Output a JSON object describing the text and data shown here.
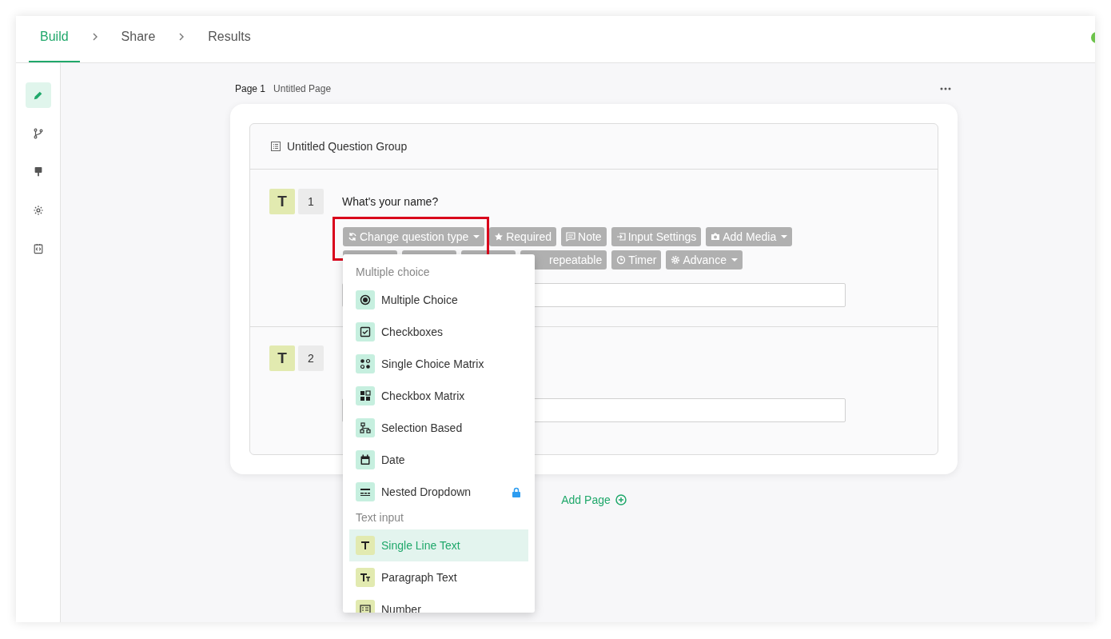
{
  "tabs": [
    {
      "label": "Build",
      "selected": true
    },
    {
      "label": "Share",
      "selected": false
    },
    {
      "label": "Results",
      "selected": false
    }
  ],
  "sidebar": {
    "items": [
      {
        "kind": "pencil",
        "selected": true
      },
      {
        "kind": "branch",
        "selected": false
      },
      {
        "kind": "brush",
        "selected": false
      },
      {
        "kind": "gear",
        "selected": false
      },
      {
        "kind": "code",
        "selected": false
      }
    ]
  },
  "page": {
    "number": "Page 1",
    "title": "Untitled Page"
  },
  "group": {
    "title": "Untitled Question Group"
  },
  "questions": [
    {
      "type": "T",
      "number": "1",
      "title": "What's your name?",
      "toolbar": [
        [
          {
            "kind": "refresh",
            "label": "Change question type",
            "caret": true
          },
          {
            "kind": "star",
            "label": "Required",
            "caret": false
          },
          {
            "kind": "note",
            "label": "Note",
            "caret": false
          },
          {
            "kind": "input",
            "label": "Input Settings",
            "caret": false
          },
          {
            "kind": "camera",
            "label": "Add Media",
            "caret": true
          }
        ],
        [
          {
            "kind": "covered"
          },
          {
            "kind": "covered"
          },
          {
            "kind": "covered"
          },
          {
            "kind": "cut",
            "label": "repeatable",
            "caret": false
          },
          {
            "kind": "clock",
            "label": "Timer",
            "caret": false
          },
          {
            "kind": "gear",
            "label": "Advance",
            "caret": true
          }
        ]
      ]
    },
    {
      "type": "T",
      "number": "2"
    }
  ],
  "type_menu": {
    "sections": [
      {
        "kind": "choice",
        "title": "Multiple choice",
        "items": [
          {
            "kind": "radio",
            "label": "Multiple Choice",
            "selected": false,
            "locked": false
          },
          {
            "kind": "checkbox",
            "label": "Checkboxes",
            "selected": false,
            "locked": false
          },
          {
            "kind": "dots",
            "label": "Single Choice Matrix",
            "selected": false,
            "locked": false
          },
          {
            "kind": "grid",
            "label": "Checkbox Matrix",
            "selected": false,
            "locked": false
          },
          {
            "kind": "tree",
            "label": "Selection Based",
            "selected": false,
            "locked": false
          },
          {
            "kind": "calendar",
            "label": "Date",
            "selected": false,
            "locked": false
          },
          {
            "kind": "nested",
            "label": "Nested Dropdown",
            "selected": false,
            "locked": true
          }
        ]
      },
      {
        "kind": "text",
        "title": "Text input",
        "items": [
          {
            "kind": "t",
            "label": "Single Line Text",
            "selected": true,
            "locked": false
          },
          {
            "kind": "tt",
            "label": "Paragraph Text",
            "selected": false,
            "locked": false
          },
          {
            "kind": "number",
            "label": "Number",
            "selected": false,
            "locked": false
          }
        ]
      }
    ]
  },
  "add_page": "Add Page"
}
